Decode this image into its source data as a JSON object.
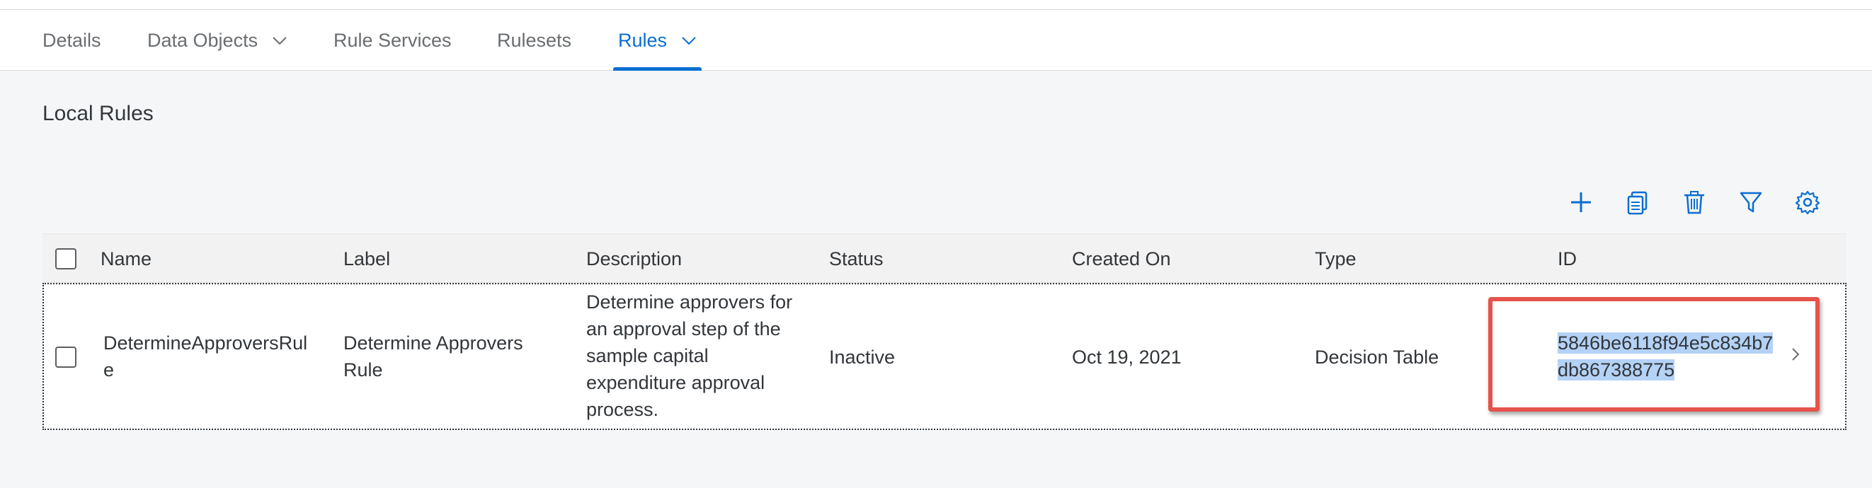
{
  "tabs": [
    {
      "label": "Details",
      "has_dropdown": false,
      "active": false
    },
    {
      "label": "Data Objects",
      "has_dropdown": true,
      "active": false
    },
    {
      "label": "Rule Services",
      "has_dropdown": false,
      "active": false
    },
    {
      "label": "Rulesets",
      "has_dropdown": false,
      "active": false
    },
    {
      "label": "Rules",
      "has_dropdown": true,
      "active": true
    }
  ],
  "section": {
    "title": "Local Rules"
  },
  "toolbar": {
    "icons": [
      "add-icon",
      "copy-icon",
      "delete-icon",
      "filter-icon",
      "settings-icon"
    ]
  },
  "table": {
    "columns": [
      "Name",
      "Label",
      "Description",
      "Status",
      "Created On",
      "Type",
      "ID"
    ],
    "rows": [
      {
        "name_line1": "DetermineApproversRul",
        "name_line2": "e",
        "label_line1": "Determine Approvers",
        "label_line2": "Rule",
        "description_lines": [
          "Determine approvers for",
          "an approval step of the",
          "sample capital",
          "expenditure approval",
          "process."
        ],
        "status": "Inactive",
        "created_on": "Oct 19, 2021",
        "type": "Decision Table",
        "id_line1": "5846be6118f94e5c834b7",
        "id_line2": "db867388775"
      }
    ]
  },
  "colors": {
    "accent": "#0a6ed1",
    "highlight": "#e5534b",
    "selection": "#b4d2f5"
  }
}
